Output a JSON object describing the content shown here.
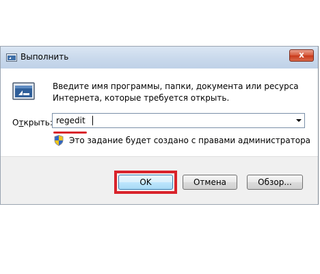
{
  "window": {
    "title": "Выполнить",
    "close_label": "x"
  },
  "content": {
    "description": "Введите имя программы, папки, документа или ресурса Интернета, которые требуется открыть.",
    "open_label_prefix": "О",
    "open_label_underlined": "т",
    "open_label_suffix": "крыть:",
    "input_value": "regedit",
    "admin_note": "Это задание будет создано с правами администратора"
  },
  "buttons": {
    "ok": "OK",
    "cancel": "Отмена",
    "browse": "Обзор..."
  },
  "colors": {
    "highlight": "#d9232b",
    "title_bar": "#c9d9ec"
  },
  "icons": {
    "title": "run-icon",
    "main": "run-icon",
    "shield": "uac-shield-icon",
    "dropdown": "chevron-down-icon",
    "close": "close-icon"
  }
}
